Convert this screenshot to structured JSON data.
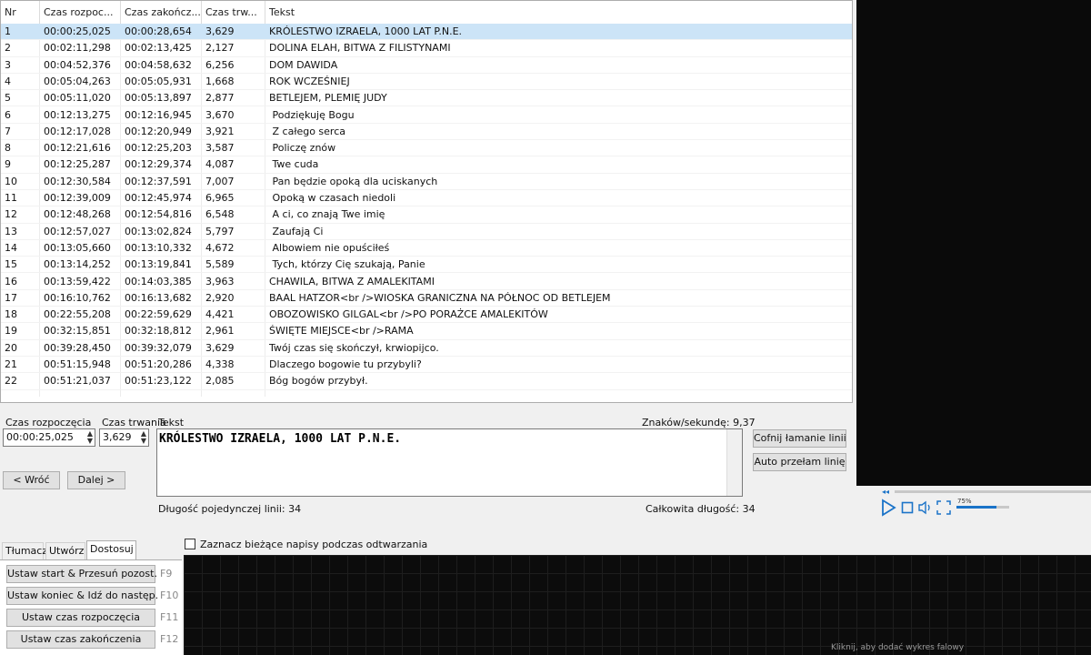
{
  "grid": {
    "columns": [
      "Nr",
      "Czas rozpoc...",
      "Czas zakończ...",
      "Czas trw...",
      "Tekst"
    ],
    "rows": [
      {
        "nr": "1",
        "start": "00:00:25,025",
        "end": "00:00:28,654",
        "dur": "3,629",
        "text": "KRÓLESTWO IZRAELA, 1000 LAT P.N.E."
      },
      {
        "nr": "2",
        "start": "00:02:11,298",
        "end": "00:02:13,425",
        "dur": "2,127",
        "text": "DOLINA ELAH, BITWA Z FILISTYNAMI"
      },
      {
        "nr": "3",
        "start": "00:04:52,376",
        "end": "00:04:58,632",
        "dur": "6,256",
        "text": "DOM DAWIDA"
      },
      {
        "nr": "4",
        "start": "00:05:04,263",
        "end": "00:05:05,931",
        "dur": "1,668",
        "text": "ROK WCZEŚNIEJ"
      },
      {
        "nr": "5",
        "start": "00:05:11,020",
        "end": "00:05:13,897",
        "dur": "2,877",
        "text": "BETLEJEM, PLEMIĘ JUDY"
      },
      {
        "nr": "6",
        "start": "00:12:13,275",
        "end": "00:12:16,945",
        "dur": "3,670",
        "text": " Podziękuję Bogu"
      },
      {
        "nr": "7",
        "start": "00:12:17,028",
        "end": "00:12:20,949",
        "dur": "3,921",
        "text": " Z całego serca"
      },
      {
        "nr": "8",
        "start": "00:12:21,616",
        "end": "00:12:25,203",
        "dur": "3,587",
        "text": " Policzę znów"
      },
      {
        "nr": "9",
        "start": "00:12:25,287",
        "end": "00:12:29,374",
        "dur": "4,087",
        "text": " Twe cuda"
      },
      {
        "nr": "10",
        "start": "00:12:30,584",
        "end": "00:12:37,591",
        "dur": "7,007",
        "text": " Pan będzie opoką dla uciskanych"
      },
      {
        "nr": "11",
        "start": "00:12:39,009",
        "end": "00:12:45,974",
        "dur": "6,965",
        "text": " Opoką w czasach niedoli"
      },
      {
        "nr": "12",
        "start": "00:12:48,268",
        "end": "00:12:54,816",
        "dur": "6,548",
        "text": " A ci, co znają Twe imię"
      },
      {
        "nr": "13",
        "start": "00:12:57,027",
        "end": "00:13:02,824",
        "dur": "5,797",
        "text": " Zaufają Ci"
      },
      {
        "nr": "14",
        "start": "00:13:05,660",
        "end": "00:13:10,332",
        "dur": "4,672",
        "text": " Albowiem nie opuściłeś"
      },
      {
        "nr": "15",
        "start": "00:13:14,252",
        "end": "00:13:19,841",
        "dur": "5,589",
        "text": " Tych, którzy Cię szukają, Panie"
      },
      {
        "nr": "16",
        "start": "00:13:59,422",
        "end": "00:14:03,385",
        "dur": "3,963",
        "text": "CHAWILA, BITWA Z AMALEKITAMI"
      },
      {
        "nr": "17",
        "start": "00:16:10,762",
        "end": "00:16:13,682",
        "dur": "2,920",
        "text": "BAAL HATZOR<br />WIOSKA GRANICZNA NA PÓŁNOC OD BETLEJEM"
      },
      {
        "nr": "18",
        "start": "00:22:55,208",
        "end": "00:22:59,629",
        "dur": "4,421",
        "text": "OBOZOWISKO GILGAL<br />PO PORAŻCE AMALEKITÓW"
      },
      {
        "nr": "19",
        "start": "00:32:15,851",
        "end": "00:32:18,812",
        "dur": "2,961",
        "text": "ŚWIĘTE MIEJSCE<br />RAMA"
      },
      {
        "nr": "20",
        "start": "00:39:28,450",
        "end": "00:39:32,079",
        "dur": "3,629",
        "text": "Twój czas się skończył, krwiopijco."
      },
      {
        "nr": "21",
        "start": "00:51:15,948",
        "end": "00:51:20,286",
        "dur": "4,338",
        "text": "Dlaczego bogowie tu przybyli?"
      },
      {
        "nr": "22",
        "start": "00:51:21,037",
        "end": "00:51:23,122",
        "dur": "2,085",
        "text": "Bóg bogów przybył."
      }
    ],
    "selected_row": 1
  },
  "edit": {
    "start_label": "Czas rozpoczęcia",
    "duration_label": "Czas trwania",
    "text_label": "Tekst",
    "start_value": "00:00:25,025",
    "duration_value": "3,629",
    "text_value": "KRÓLESTWO IZRAELA, 1000 LAT P.N.E.",
    "chars_per_sec": "Znaków/sekundę: 9,37",
    "single_line_length": "Długość pojedynczej linii: 34",
    "total_length": "Całkowita długość: 34",
    "prev_button": "< Wróć",
    "next_button": "Dalej >",
    "undo_break_button": "Cofnij łamanie linii",
    "auto_break_button": "Auto przełam linię"
  },
  "video": {
    "volume_label": "75%",
    "volume_level": 0.75
  },
  "tabs": [
    "Tłumacz",
    "Utwórz",
    "Dostosuj"
  ],
  "active_tab": "Dostosuj",
  "adjust_buttons": [
    {
      "label": "Ustaw start & Przesuń pozost.",
      "key": "F9"
    },
    {
      "label": "Ustaw koniec & Idź do następ.",
      "key": "F10"
    },
    {
      "label": "Ustaw czas rozpoczęcia",
      "key": "F11"
    },
    {
      "label": "Ustaw czas zakończenia",
      "key": "F12"
    }
  ],
  "waveform": {
    "checkbox_label": "Zaznacz bieżące napisy podczas odtwarzania",
    "hint": "Kliknij, aby dodać wykres falowy"
  },
  "colors": {
    "selection": "#cce4f7",
    "accent": "#1a73c8",
    "video_bg": "#0a0a0a",
    "waveform_bg": "#0c0c0c"
  }
}
